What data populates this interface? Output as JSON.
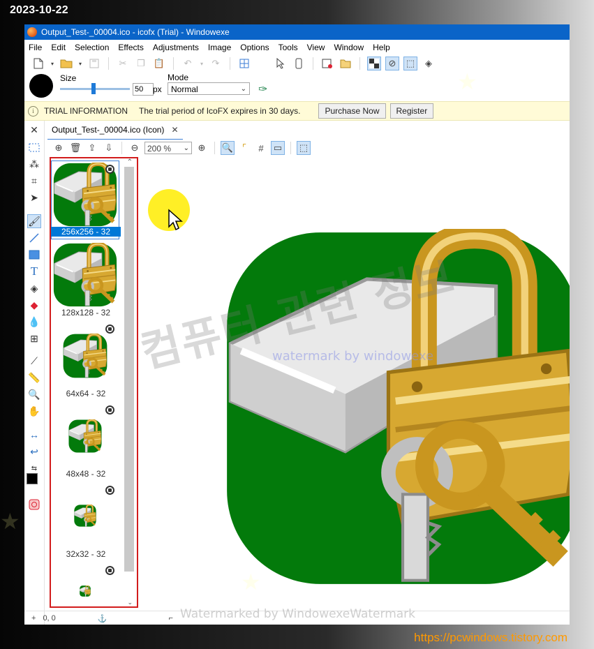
{
  "overlay": {
    "date": "2023-10-22",
    "site_url": "https://pcwindows.tistory.com",
    "watermark_korean": "컴퓨터 관련 정보",
    "watermark_small": "watermark by windowexe",
    "watermark_bottom": "Watermarked by WindowexeWatermark"
  },
  "window": {
    "title": "Output_Test-_00004.ico - icofx (Trial)  - Windowexe"
  },
  "menu": [
    "File",
    "Edit",
    "Selection",
    "Effects",
    "Adjustments",
    "Image",
    "Options",
    "Tools",
    "View",
    "Window",
    "Help"
  ],
  "properties": {
    "size_label": "Size",
    "size_value": "50",
    "size_unit": "px",
    "size_fraction": 0.5,
    "mode_label": "Mode",
    "mode_value": "Normal"
  },
  "trial": {
    "title": "TRIAL INFORMATION",
    "message": "The trial period of IcoFX expires in 30 days.",
    "purchase_label": "Purchase Now",
    "register_label": "Register"
  },
  "document": {
    "tab_label": "Output_Test-_00004.ico (Icon)",
    "zoom": "200 %"
  },
  "pages": [
    {
      "label": "256x256 - 32",
      "selected": true
    },
    {
      "label": "128x128 - 32",
      "selected": false
    },
    {
      "label": "64x64 - 32",
      "selected": false
    },
    {
      "label": "48x48 - 32",
      "selected": false
    },
    {
      "label": "32x32 - 32",
      "selected": false
    },
    {
      "label": "",
      "selected": false
    }
  ],
  "status": {
    "coords": "0, 0"
  },
  "colors": {
    "icon_green": "#037a0b",
    "accent_blue": "#0078d7",
    "panel_highlight": "#d21c1c",
    "titlebar": "#0a64c8"
  }
}
